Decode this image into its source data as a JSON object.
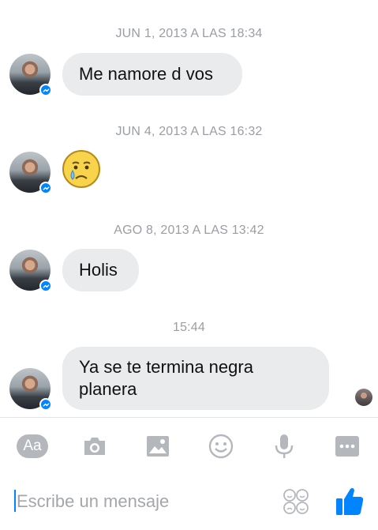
{
  "messages": [
    {
      "timestamp": "JUN 1, 2013 A LAS 18:34",
      "text": "Me namore d vos"
    },
    {
      "timestamp": "JUN 4, 2013 A LAS 16:32",
      "emoji": "crying-face"
    },
    {
      "timestamp": "AGO 8, 2013 A LAS 13:42",
      "text": "Holis"
    },
    {
      "timestamp": "15:44",
      "text_line1": "Ya se te termina negra",
      "text_line2": "planera"
    }
  ],
  "composer": {
    "placeholder": "Escribe un mensaje"
  },
  "toolbar": {
    "text_button_label": "Aa",
    "icons": [
      "camera-icon",
      "image-icon",
      "emoji-icon",
      "microphone-icon",
      "more-icon"
    ]
  },
  "colors": {
    "bubble": "#eaebed",
    "accent": "#0084ff",
    "icon": "#b4b8bd",
    "timestamp": "#9a9ea4"
  }
}
